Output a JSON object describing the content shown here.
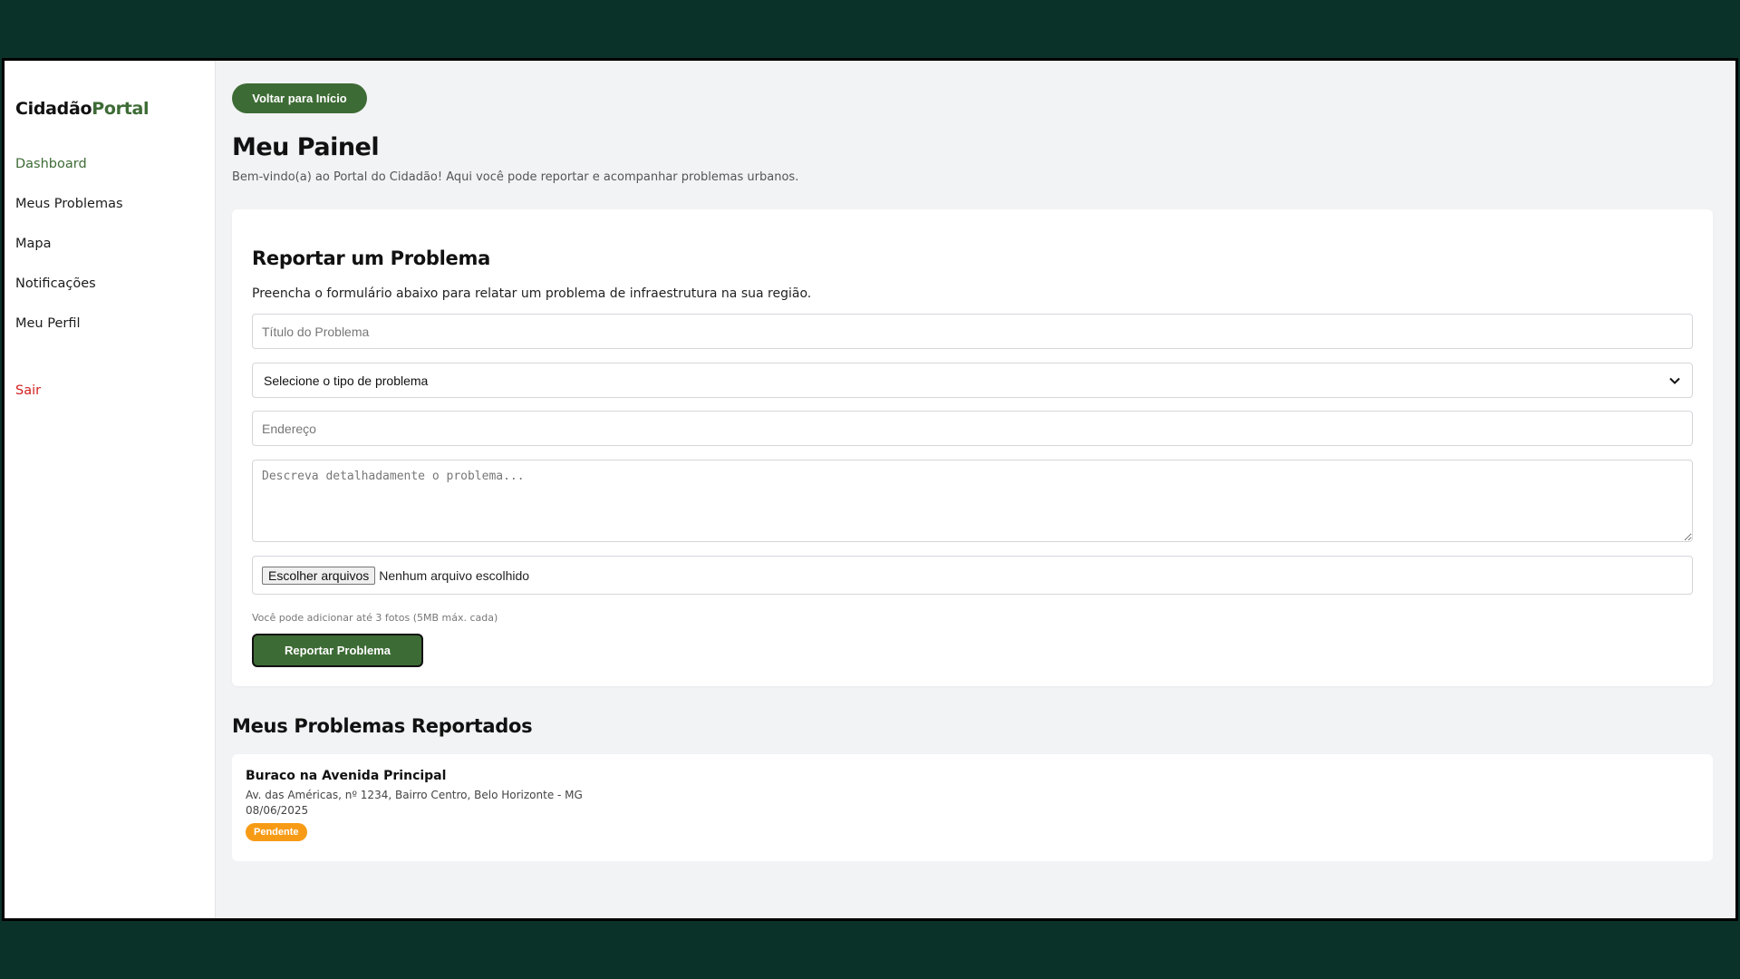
{
  "brand": {
    "name_main": "Cidadão",
    "name_accent": "Portal",
    "accent_color": "#3d6b35"
  },
  "sidebar": {
    "items": [
      {
        "label": "Dashboard"
      },
      {
        "label": "Meus Problemas"
      },
      {
        "label": "Mapa"
      },
      {
        "label": "Notificações"
      },
      {
        "label": "Meu Perfil"
      }
    ],
    "logout_label": "Sair"
  },
  "header": {
    "back_button": "Voltar para Início",
    "title": "Meu Painel",
    "subtitle": "Bem-vindo(a) ao Portal do Cidadão! Aqui você pode reportar e acompanhar problemas urbanos."
  },
  "report_form": {
    "title": "Reportar um Problema",
    "description": "Preencha o formulário abaixo para relatar um problema de infraestrutura na sua região.",
    "title_placeholder": "Título do Problema",
    "type_select_value": "Selecione o tipo de problema",
    "address_placeholder": "Endereço",
    "description_placeholder": "Descreva detalhadamente o problema...",
    "file_button": "Escolher arquivos",
    "file_status": "Nenhum arquivo escolhido",
    "file_hint": "Você pode adicionar até 3 fotos (5MB máx. cada)",
    "submit_label": "Reportar Problema"
  },
  "reported": {
    "title": "Meus Problemas Reportados",
    "items": [
      {
        "title": "Buraco na Avenida Principal",
        "address": "Av. das Américas, nº 1234, Bairro Centro, Belo Horizonte - MG",
        "date": "08/06/2025",
        "status": "Pendente",
        "status_color": "#f79b16"
      }
    ]
  }
}
